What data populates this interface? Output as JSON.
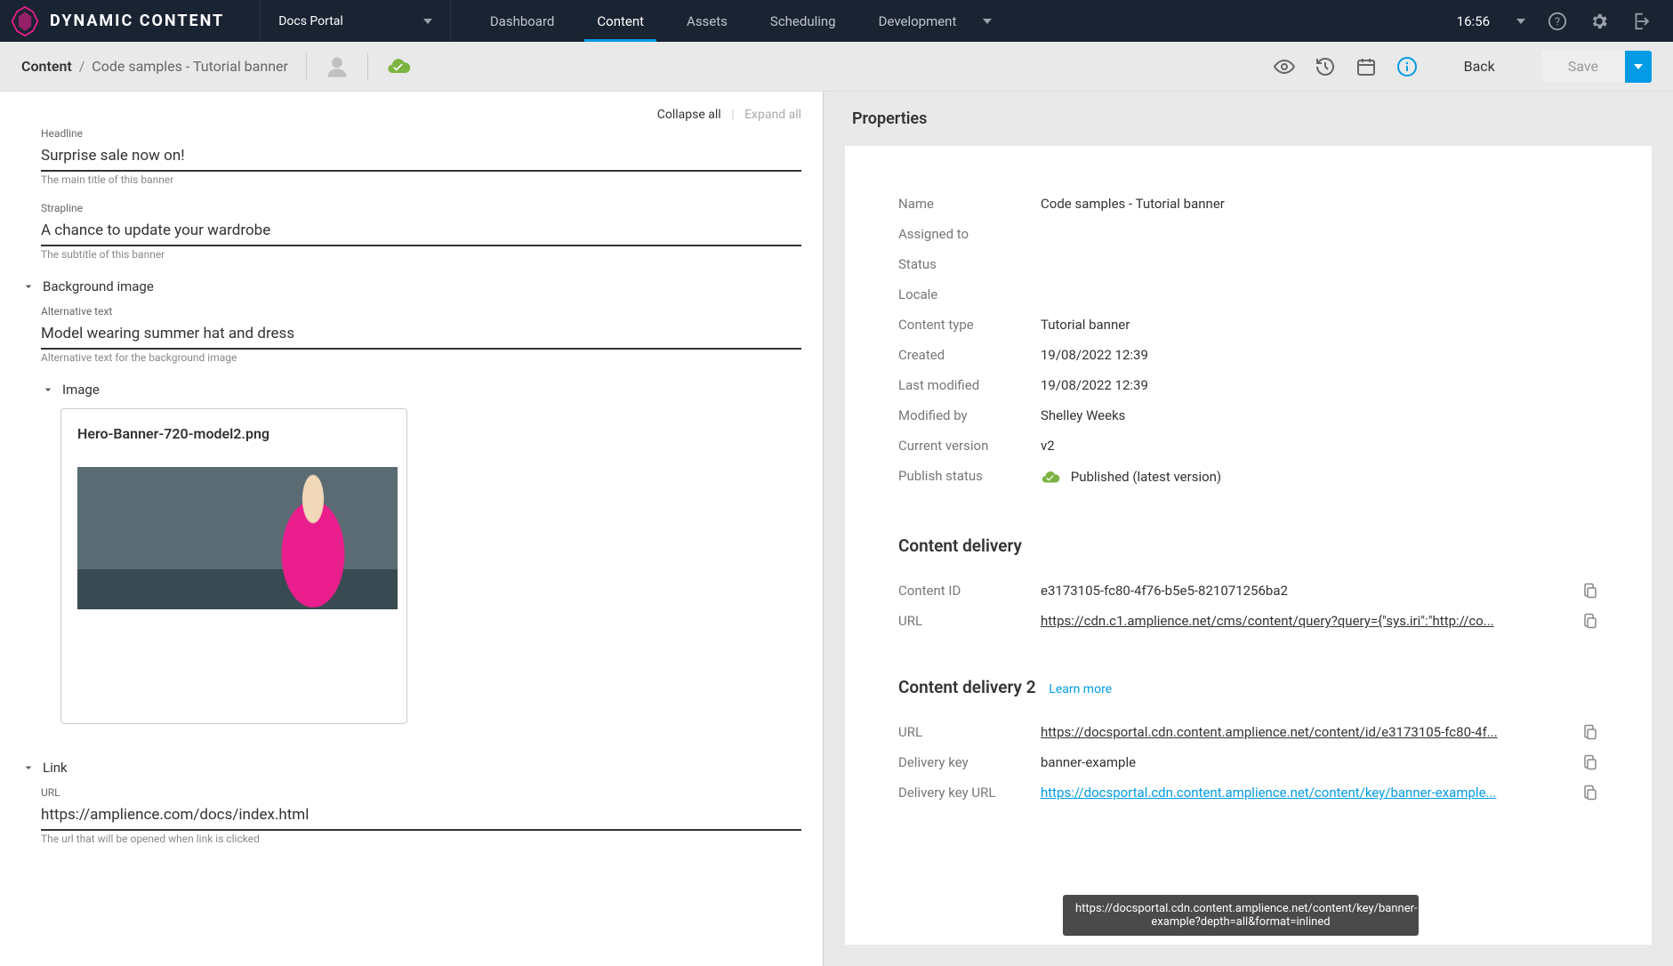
{
  "brand": "DYNAMIC CONTENT",
  "portal": "Docs Portal",
  "nav": {
    "dashboard": "Dashboard",
    "content": "Content",
    "assets": "Assets",
    "scheduling": "Scheduling",
    "development": "Development"
  },
  "time": "16:56",
  "breadcrumb": {
    "root": "Content",
    "leaf": "Code samples - Tutorial banner"
  },
  "actions": {
    "back": "Back",
    "save": "Save",
    "collapse": "Collapse all",
    "expand": "Expand all"
  },
  "form": {
    "headline": {
      "label": "Headline",
      "value": "Surprise sale now on!",
      "hint": "The main title of this banner"
    },
    "strapline": {
      "label": "Strapline",
      "value": "A chance to update your wardrobe",
      "hint": "The subtitle of this banner"
    },
    "bg_section": "Background image",
    "alt": {
      "label": "Alternative text",
      "value": "Model wearing summer hat and dress",
      "hint": "Alternative text for the background image"
    },
    "image_section": "Image",
    "image_filename": "Hero-Banner-720-model2.png",
    "link_section": "Link",
    "url": {
      "label": "URL",
      "value": "https://amplience.com/docs/index.html",
      "hint": "The url that will be opened when link is clicked"
    }
  },
  "props": {
    "title": "Properties",
    "labels": {
      "name": "Name",
      "assigned": "Assigned to",
      "status": "Status",
      "locale": "Locale",
      "ctype": "Content type",
      "created": "Created",
      "modified": "Last modified",
      "modby": "Modified by",
      "version": "Current version",
      "pubstatus": "Publish status"
    },
    "name": "Code samples - Tutorial banner",
    "assigned": "",
    "status": "",
    "locale": "",
    "ctype": "Tutorial banner",
    "created": "19/08/2022 12:39",
    "modified": "19/08/2022 12:39",
    "modby": "Shelley Weeks",
    "version": "v2",
    "pubstatus": "Published (latest version)"
  },
  "cd1": {
    "title": "Content delivery",
    "labels": {
      "id": "Content ID",
      "url": "URL"
    },
    "id": "e3173105-fc80-4f76-b5e5-821071256ba2",
    "url": "https://cdn.c1.amplience.net/cms/content/query?query={\"sys.iri\":\"http://co..."
  },
  "cd2": {
    "title": "Content delivery 2",
    "learn": "Learn more",
    "labels": {
      "url": "URL",
      "dkey": "Delivery key",
      "dkeyurl": "Delivery key URL"
    },
    "url": "https://docsportal.cdn.content.amplience.net/content/id/e3173105-fc80-4f...",
    "dkey": "banner-example",
    "dkeyurl": "https://docsportal.cdn.content.amplience.net/content/key/banner-example..."
  },
  "tooltip": "https://docsportal.cdn.content.amplience.net/content/key/banner-example?depth=all&format=inlined"
}
